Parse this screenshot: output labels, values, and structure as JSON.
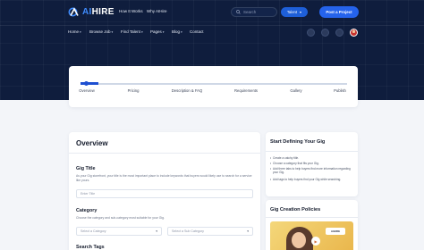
{
  "brand": {
    "name_prefix": "AI",
    "name_suffix": "HIRE"
  },
  "header": {
    "links": [
      "How It Works",
      "Why AIHire"
    ],
    "search_placeholder": "Search",
    "talent_label": "Talent",
    "post_button": "Post a Project"
  },
  "nav": {
    "items": [
      "Home",
      "Browse Job",
      "Find Talent",
      "Pages",
      "Blog",
      "Contact"
    ],
    "icons": [
      "heart-icon",
      "message-icon",
      "notification-icon"
    ]
  },
  "steps": {
    "labels": [
      "Overview",
      "Pricing",
      "Description & FAQ",
      "Requirements",
      "Gallery",
      "Publish"
    ],
    "progress": 0.07
  },
  "overview": {
    "title": "Overview",
    "gig_title": {
      "label": "Gig Title",
      "help": "As your Gig storefront, your title is the most important place to include keywords that buyers would likely use to search for a service like yours.",
      "placeholder": "Enter Title"
    },
    "category": {
      "label": "Category",
      "help": "Choose the category and sub-category most suitable for your Gig.",
      "select_category": "Select a Category",
      "select_subcategory": "Select a Sub Category"
    },
    "search_tags": {
      "label": "Search Tags"
    }
  },
  "sidebar": {
    "defining_title": "Start Defining Your Gig",
    "tips": [
      "Create a catchy title.",
      "Choose a category that fits your Gig.",
      "Add three tabs to help buyers find more information regarding your Gig.",
      "Add tags to help buyers find your Gig while searching."
    ],
    "policies_title": "Gig Creation Policies",
    "video_tag": "AIHIRE"
  }
}
